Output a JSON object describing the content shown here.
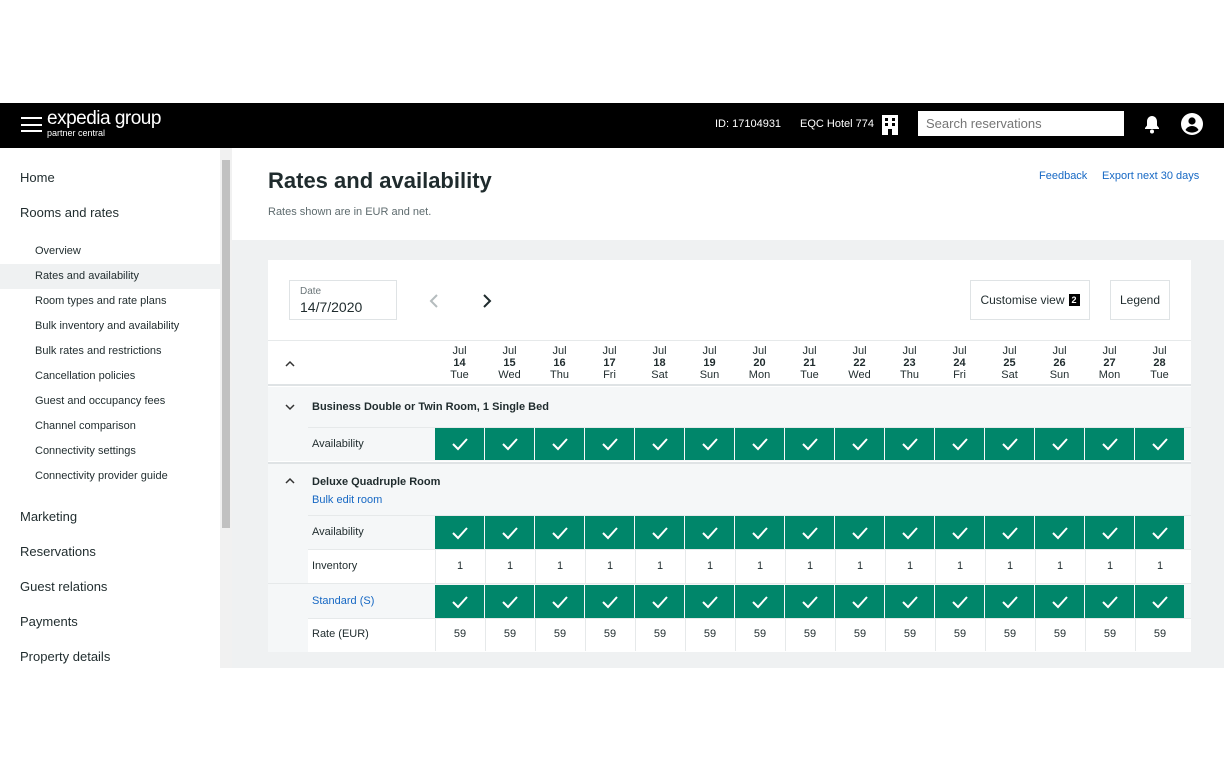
{
  "header": {
    "brand": "expedia group",
    "sub_brand": "partner central",
    "property_id": "ID: 17104931",
    "hotel_name": "EQC Hotel 774",
    "search_placeholder": "Search reservations"
  },
  "sidebar": {
    "items": [
      {
        "label": "Home"
      },
      {
        "label": "Rooms and rates"
      }
    ],
    "sub_items": [
      {
        "label": "Overview"
      },
      {
        "label": "Rates and availability",
        "active": true
      },
      {
        "label": "Room types and rate plans"
      },
      {
        "label": "Bulk inventory and availability"
      },
      {
        "label": "Bulk rates and restrictions"
      },
      {
        "label": "Cancellation policies"
      },
      {
        "label": "Guest and occupancy fees"
      },
      {
        "label": "Channel comparison"
      },
      {
        "label": "Connectivity settings"
      },
      {
        "label": "Connectivity provider guide"
      }
    ],
    "more_items": [
      {
        "label": "Marketing"
      },
      {
        "label": "Reservations"
      },
      {
        "label": "Guest relations"
      },
      {
        "label": "Payments"
      },
      {
        "label": "Property details"
      }
    ]
  },
  "page": {
    "title": "Rates and availability",
    "subtitle": "Rates shown are in EUR and net.",
    "feedback": "Feedback",
    "export": "Export next 30 days"
  },
  "controls": {
    "date_label": "Date",
    "date_value": "14/7/2020",
    "customise": "Customise view",
    "customise_count": "2",
    "legend": "Legend"
  },
  "colors": {
    "available": "#00866a",
    "link": "#1668c4"
  },
  "dates": [
    {
      "m": "Jul",
      "d": "14",
      "w": "Tue"
    },
    {
      "m": "Jul",
      "d": "15",
      "w": "Wed"
    },
    {
      "m": "Jul",
      "d": "16",
      "w": "Thu"
    },
    {
      "m": "Jul",
      "d": "17",
      "w": "Fri"
    },
    {
      "m": "Jul",
      "d": "18",
      "w": "Sat"
    },
    {
      "m": "Jul",
      "d": "19",
      "w": "Sun"
    },
    {
      "m": "Jul",
      "d": "20",
      "w": "Mon"
    },
    {
      "m": "Jul",
      "d": "21",
      "w": "Tue"
    },
    {
      "m": "Jul",
      "d": "22",
      "w": "Wed"
    },
    {
      "m": "Jul",
      "d": "23",
      "w": "Thu"
    },
    {
      "m": "Jul",
      "d": "24",
      "w": "Fri"
    },
    {
      "m": "Jul",
      "d": "25",
      "w": "Sat"
    },
    {
      "m": "Jul",
      "d": "26",
      "w": "Sun"
    },
    {
      "m": "Jul",
      "d": "27",
      "w": "Mon"
    },
    {
      "m": "Jul",
      "d": "28",
      "w": "Tue"
    }
  ],
  "rooms": [
    {
      "name": "Business Double or Twin Room, 1 Single Bed",
      "expanded": false,
      "availability_label": "Availability"
    },
    {
      "name": "Deluxe Quadruple Room",
      "expanded": true,
      "bulk_edit": "Bulk edit room",
      "availability_label": "Availability",
      "inventory_label": "Inventory",
      "inventory": [
        1,
        1,
        1,
        1,
        1,
        1,
        1,
        1,
        1,
        1,
        1,
        1,
        1,
        1,
        1
      ],
      "rate_plan": "Standard (S)",
      "rate_label": "Rate (EUR)",
      "rates": [
        59,
        59,
        59,
        59,
        59,
        59,
        59,
        59,
        59,
        59,
        59,
        59,
        59,
        59,
        59
      ]
    }
  ]
}
